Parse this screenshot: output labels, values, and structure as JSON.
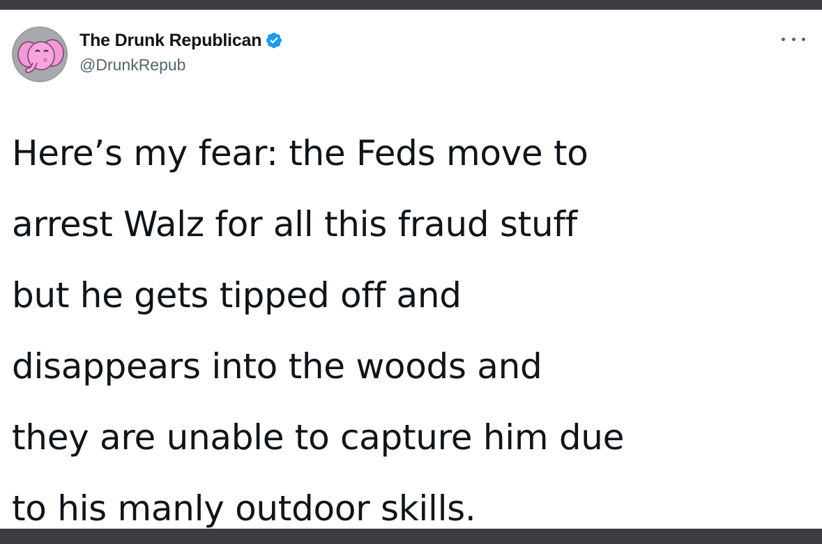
{
  "tweet": {
    "author": {
      "display_name": "The Drunk Republican",
      "handle": "@DrunkRepub",
      "verified": true,
      "avatar_icon": "pink-elephant-avatar"
    },
    "more_menu_icon": "more-options-icon",
    "text_lines": [
      "Here’s my fear: the Feds move to",
      "arrest Walz for all this fraud stuff",
      "but he gets tipped off and",
      "disappears into the woods and",
      "they are unable to capture him due",
      "to his manly outdoor skills."
    ]
  },
  "colors": {
    "background_frame": "#3b3d40",
    "card": "#ffffff",
    "text_primary": "#0f1419",
    "text_secondary": "#536471",
    "verified_badge": "#1d9bf0",
    "avatar_pink": "#f29ad8"
  }
}
